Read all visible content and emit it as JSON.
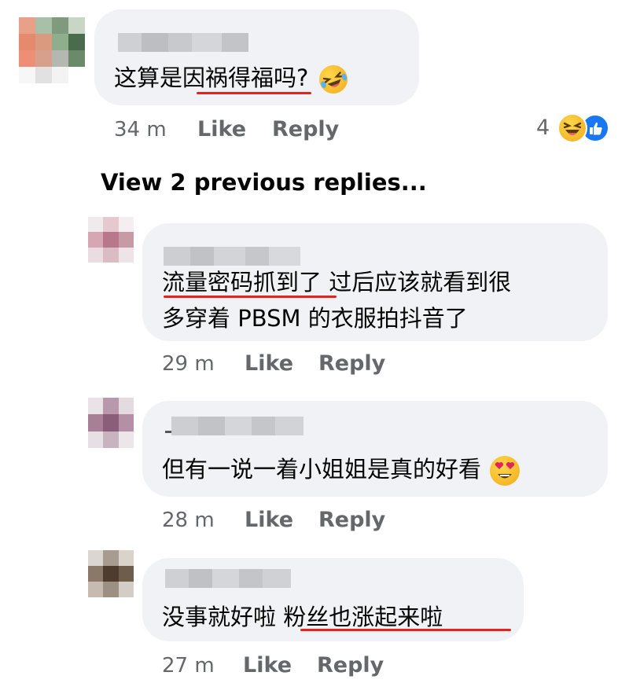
{
  "comment": {
    "text_before": "这算是",
    "text_underlined": "因祸得福",
    "text_after": "吗?",
    "emoji": "rolling-on-floor-laughing-emoji",
    "time": "34 m",
    "like_label": "Like",
    "reply_label": "Reply",
    "reaction_count": "4",
    "reactions": [
      "haha-reaction-icon",
      "like-reaction-icon"
    ]
  },
  "view_previous_replies": "View 2 previous replies...",
  "replies": [
    {
      "line1_underlined": "流量密码抓到",
      "line1_rest": "了 过后应该就看到很",
      "line2": "多穿着 PBSM 的衣服拍抖音了",
      "time": "29 m",
      "like_label": "Like",
      "reply_label": "Reply"
    },
    {
      "text": "但有一说一着小姐姐是真的好看",
      "emoji": "heart-eyes-emoji",
      "time": "28 m",
      "like_label": "Like",
      "reply_label": "Reply"
    },
    {
      "text_before": "没事就好啦 ",
      "text_underlined": "粉丝也涨起来啦",
      "time": "27 m",
      "like_label": "Like",
      "reply_label": "Reply"
    }
  ],
  "colors": {
    "bubble": "#f0f2f5",
    "meta_text": "#65676b",
    "underline": "#e4211b",
    "like_blue": "#1877f2",
    "haha_yellow": "#f7b125"
  }
}
